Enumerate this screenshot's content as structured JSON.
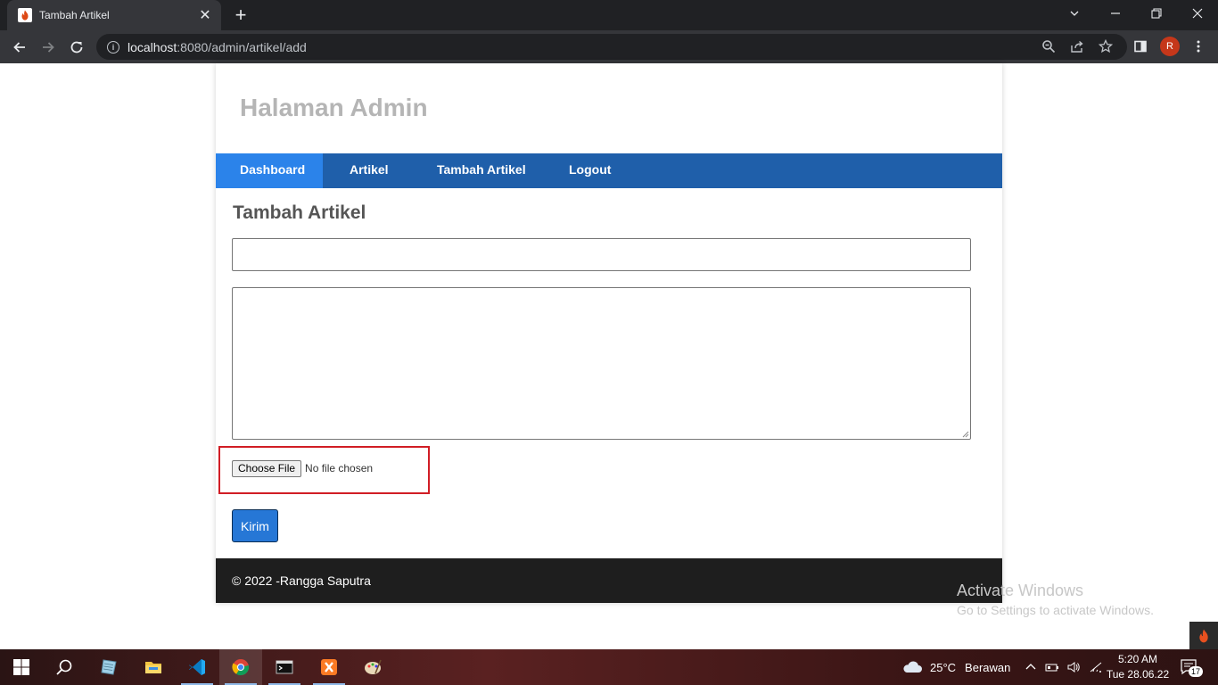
{
  "browser": {
    "tab_title": "Tambah Artikel",
    "tab_close": "✕",
    "new_tab": "+",
    "url_host": "localhost",
    "url_path": ":8080/admin/artikel/add",
    "profile_initial": "R"
  },
  "page": {
    "site_title": "Halaman Admin",
    "nav": [
      {
        "label": "Dashboard",
        "active": true
      },
      {
        "label": "Artikel",
        "active": false
      },
      {
        "label": "Tambah Artikel",
        "active": false
      },
      {
        "label": "Logout",
        "active": false
      }
    ],
    "heading": "Tambah Artikel",
    "title_input_value": "",
    "content_textarea_value": "",
    "file_button_label": "Choose File",
    "file_status": "No file chosen",
    "submit_label": "Kirim",
    "footer": "© 2022 -Rangga Saputra"
  },
  "watermark": {
    "line1": "Activate Windows",
    "line2": "Go to Settings to activate Windows."
  },
  "taskbar": {
    "weather_temp": "25°C",
    "weather_desc": "Berawan",
    "time": "5:20 AM",
    "date": "Tue 28.06.22",
    "notification_count": "17"
  },
  "colors": {
    "nav_bg": "#1f5faa",
    "nav_active": "#2b83ea",
    "submit_bg": "#2677d6",
    "footer_bg": "#1e1e1e",
    "highlight": "#d11d25"
  }
}
